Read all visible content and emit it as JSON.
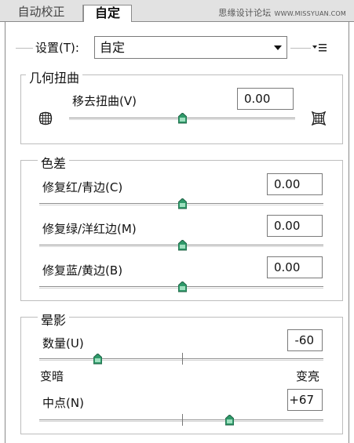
{
  "tabs": [
    {
      "label": "自动校正",
      "active": false
    },
    {
      "label": "自定",
      "active": true
    }
  ],
  "watermark": {
    "text": "思缘设计论坛",
    "url": "WWW.MISSYUAN.COM"
  },
  "settings": {
    "label": "设置(T):",
    "value": "自定"
  },
  "geometric": {
    "title": "几何扭曲",
    "remove_distortion": {
      "label": "移去扭曲(V)",
      "value": "0.00",
      "level": 0.5
    },
    "icons": {
      "left": "grid-barrel-icon",
      "right": "grid-pincushion-icon"
    }
  },
  "chromatic": {
    "title": "色差",
    "sliders": [
      {
        "label": "修复红/青边(C)",
        "value": "0.00",
        "level": 0.5
      },
      {
        "label": "修复绿/洋红边(M)",
        "value": "0.00",
        "level": 0.5
      },
      {
        "label": "修复蓝/黄边(B)",
        "value": "0.00",
        "level": 0.5
      }
    ]
  },
  "vignette": {
    "title": "晕影",
    "amount": {
      "label": "数量(U)",
      "value": "-60",
      "level": 0.2
    },
    "darken_label": "变暗",
    "brighten_label": "变亮",
    "midpoint": {
      "label": "中点(N)",
      "value": "+67",
      "level": 0.67
    }
  },
  "colors": {
    "accent_thumb": "#2f9a6a",
    "border": "#bdbdbd"
  }
}
